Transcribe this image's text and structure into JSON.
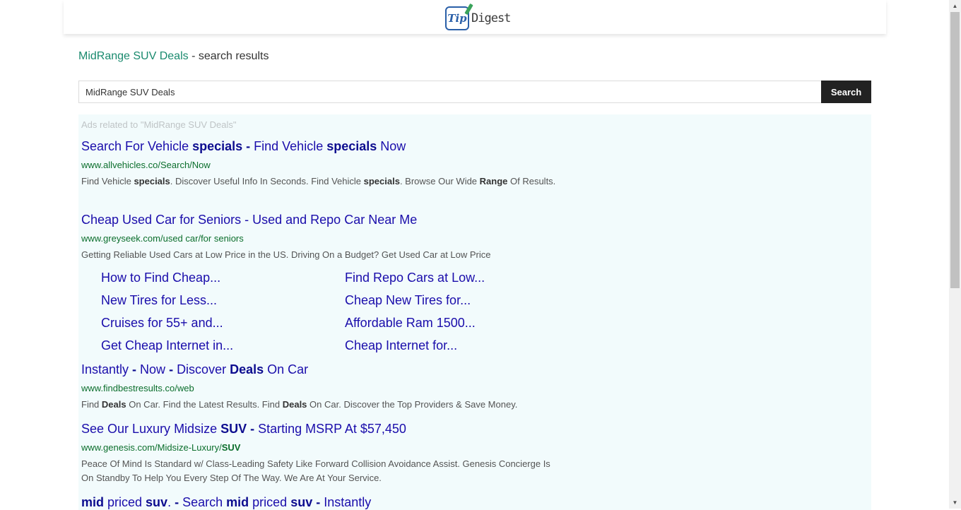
{
  "header": {
    "logo_text": "Digest",
    "logo_badge": "Tip"
  },
  "page": {
    "query": "MidRange SUV Deals",
    "title_suffix": " - search results"
  },
  "search": {
    "value": "MidRange SUV Deals",
    "button_label": "Search"
  },
  "ads": {
    "label": "Ads related to \"MidRange SUV Deals\"",
    "items": [
      {
        "title_parts": [
          "Search For Vehicle ",
          "specials",
          " - ",
          "Find Vehicle ",
          "specials",
          " Now"
        ],
        "url": "www.allvehicles.co/Search/Now",
        "desc_parts": [
          "Find Vehicle ",
          "specials",
          ". Discover Useful Info In Seconds. Find Vehicle ",
          "specials",
          ". Browse Our Wide ",
          "Range",
          " Of Results."
        ]
      },
      {
        "title": "Cheap Used Car for Seniors - Used and Repo Car Near Me",
        "url": "www.greyseek.com/used car/for seniors",
        "desc": "Getting Reliable Used Cars at Low Price in the US. Driving On a Budget? Get Used Car at Low Price",
        "sitelinks": [
          "How to Find Cheap...",
          "Find Repo Cars at Low...",
          "New Tires for Less...",
          "Cheap New Tires for...",
          "Cruises for 55+ and...",
          "Affordable Ram 1500...",
          "Get Cheap Internet in...",
          "Cheap Internet for..."
        ]
      },
      {
        "title_parts": [
          "Instantly ",
          "- ",
          "Now ",
          "- ",
          "Discover ",
          "Deals",
          " On Car"
        ],
        "url": "www.findbestresults.co/web",
        "desc_parts": [
          "Find ",
          "Deals",
          " On Car. Find the Latest Results. Find ",
          "Deals",
          " On Car. Discover the Top Providers & Save Money."
        ]
      },
      {
        "title_parts": [
          "See Our Luxury Midsize ",
          "SUV",
          " - ",
          "Starting MSRP At $57,450"
        ],
        "url_parts": [
          "www.genesis.com/Midsize-Luxury/",
          "SUV"
        ],
        "desc": "Peace Of Mind Is Standard w/ Class-Leading Safety Like Forward Collision Avoidance Assist. Genesis Concierge Is On Standby To Help You Every Step Of The Way. We Are At Your Service."
      },
      {
        "title_parts": [
          "mid",
          " priced ",
          "suv",
          ". ",
          "- ",
          "Search ",
          "mid",
          " priced ",
          "suv",
          " - ",
          "Instantly"
        ]
      }
    ]
  }
}
